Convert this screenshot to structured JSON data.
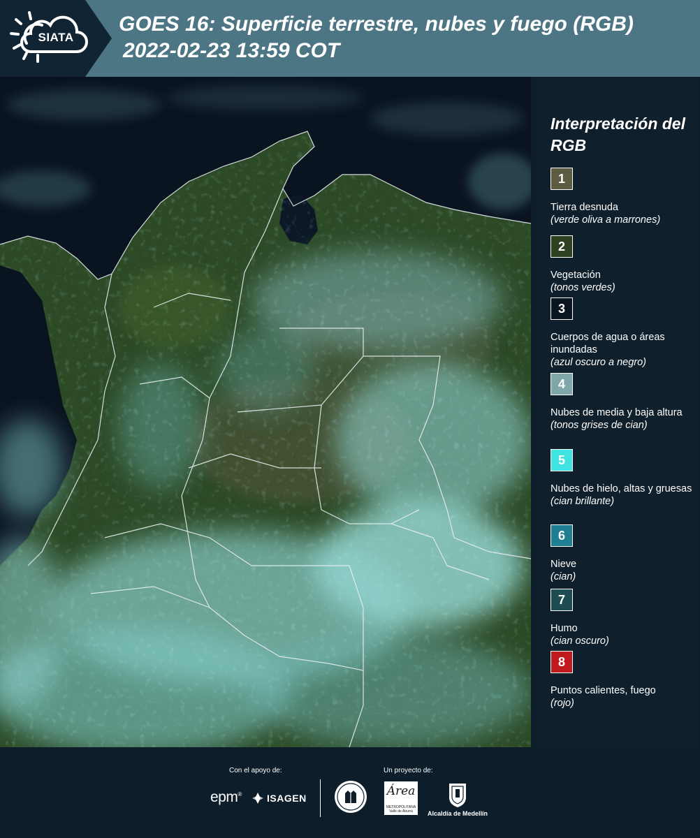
{
  "header": {
    "logo_text": "SIATA",
    "title": "GOES 16: Superficie terrestre, nubes y fuego (RGB)",
    "datetime": "2022-02-23 13:59 COT"
  },
  "map": {
    "description_icon": "satellite-rgb-image"
  },
  "legend": {
    "title": "Interpretación del RGB",
    "items": [
      {
        "number": "1",
        "color": "#5c5d40",
        "label": "Tierra desnuda",
        "description": "(verde oliva a marrones)"
      },
      {
        "number": "2",
        "color": "#2f4020",
        "label": "Vegetación",
        "description": "(tonos verdes)"
      },
      {
        "number": "3",
        "color": "#0b1520",
        "label": "Cuerpos de agua o áreas inundadas",
        "description": "(azul oscuro a negro)"
      },
      {
        "number": "4",
        "color": "#7fa7a9",
        "label": "Nubes de media y baja altura",
        "description": "(tonos grises de cian)"
      },
      {
        "number": "5",
        "color": "#3fe3e1",
        "label": "Nubes de hielo, altas y gruesas",
        "description": "(cian brillante)"
      },
      {
        "number": "6",
        "color": "#1e7f92",
        "label": "Nieve",
        "description": "(cian)"
      },
      {
        "number": "7",
        "color": "#1d4d52",
        "label": "Humo",
        "description": "(cian oscuro)"
      },
      {
        "number": "8",
        "color": "#c11a1c",
        "label": "Puntos calientes, fuego",
        "description": "(rojo)"
      }
    ]
  },
  "footer": {
    "support_label": "Con el apoyo de:",
    "project_label": "Un proyecto de:",
    "epm": "epm",
    "epm_mark": "®",
    "isagen": "ISAGEN",
    "area_logo_text": "Área",
    "area_logo_sub": "METROPOLITANA Valle de Aburrá",
    "alcaldia": "Alcaldía de Medellín"
  }
}
